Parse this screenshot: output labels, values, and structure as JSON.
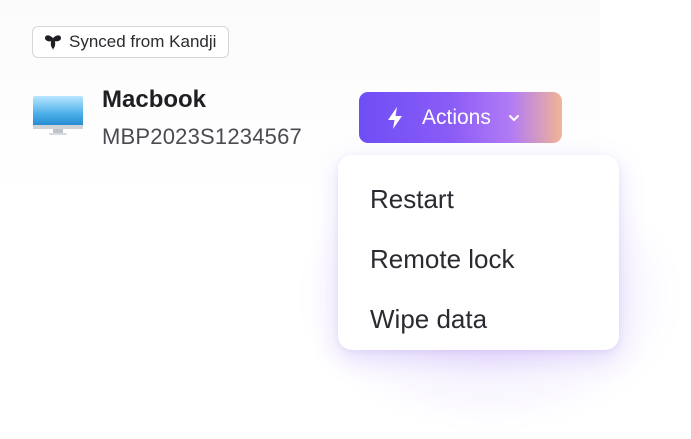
{
  "badge": {
    "icon": "bee-icon",
    "label": "Synced from Kandji"
  },
  "device": {
    "icon": "imac-icon",
    "name": "Macbook",
    "serial": "MBP2023S1234567"
  },
  "actions_button": {
    "icon": "lightning-bolt-icon",
    "label": "Actions",
    "chevron": "chevron-down-icon",
    "gradient": [
      "#6f4ef6",
      "#8a5cf6",
      "#b27bf5",
      "#f1b595"
    ]
  },
  "actions_menu": {
    "items": [
      {
        "label": "Restart"
      },
      {
        "label": "Remote lock"
      },
      {
        "label": "Wipe data"
      }
    ]
  }
}
